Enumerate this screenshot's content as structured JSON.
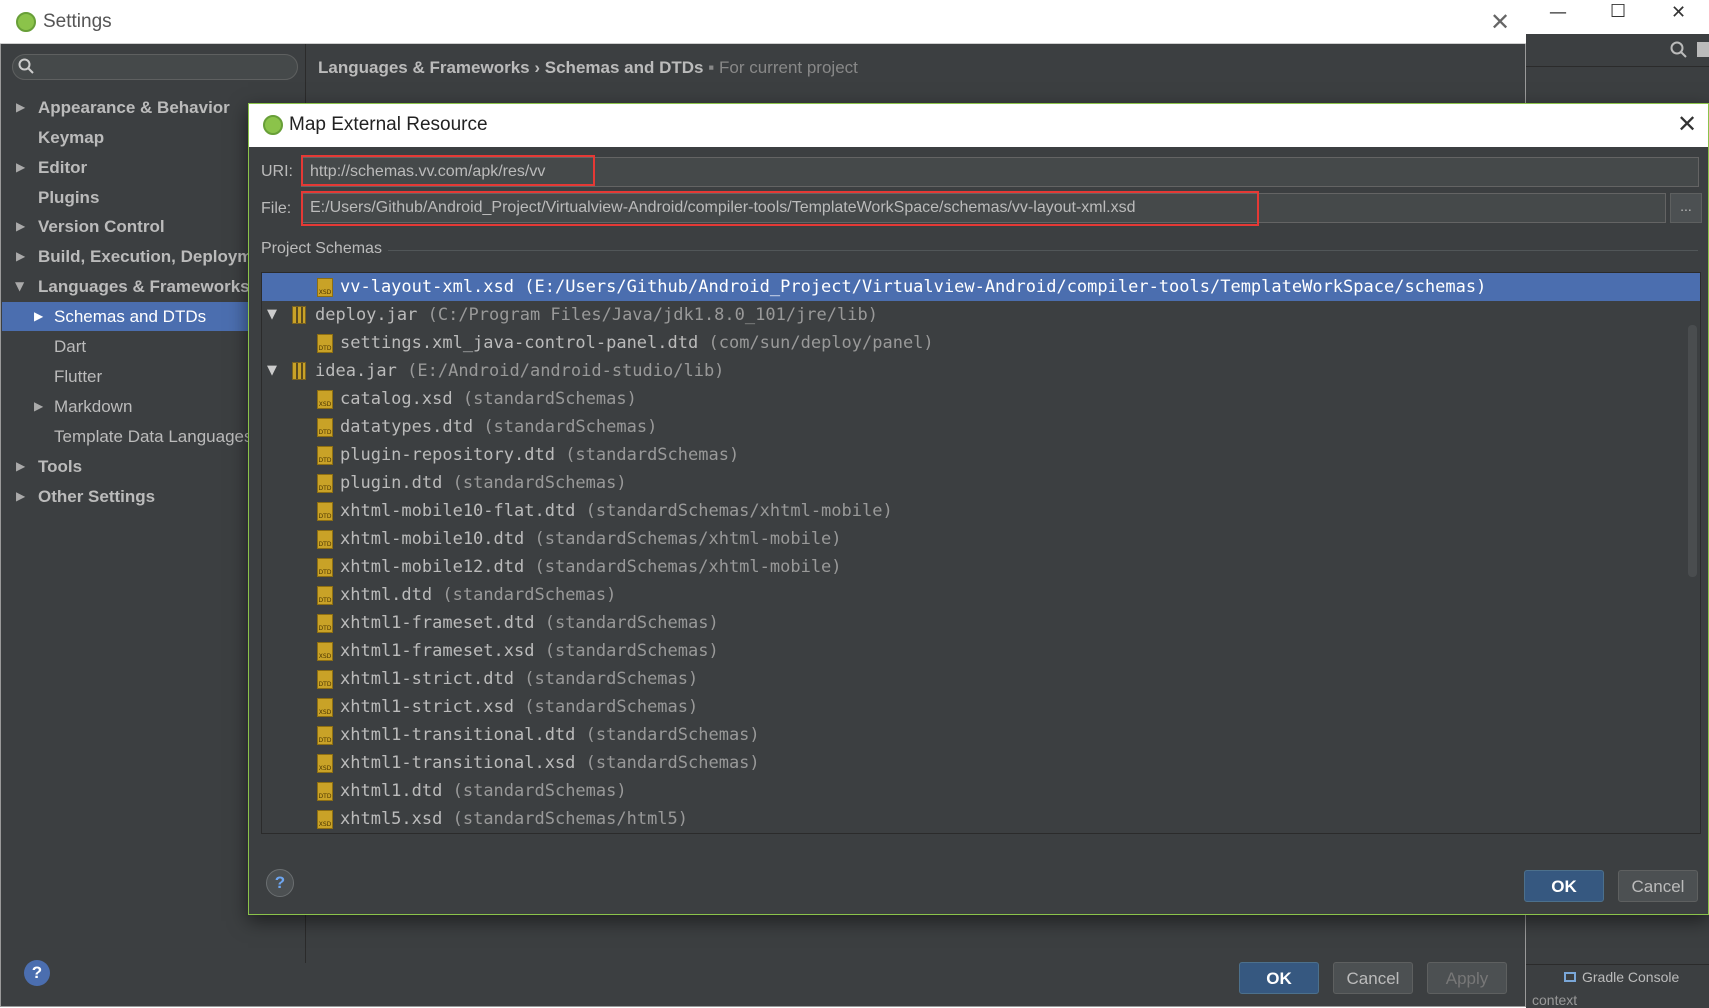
{
  "background_ide": {
    "window_controls": [
      "—",
      "☐",
      "✕"
    ],
    "tool_window_label": "Gradle Console",
    "status_text": "context"
  },
  "settings": {
    "title": "Settings",
    "search": {
      "value": "",
      "placeholder": ""
    },
    "nav": [
      {
        "label": "Appearance & Behavior",
        "bold": true,
        "expandable": true
      },
      {
        "label": "Keymap",
        "bold": true,
        "expandable": false
      },
      {
        "label": "Editor",
        "bold": true,
        "expandable": true
      },
      {
        "label": "Plugins",
        "bold": true,
        "expandable": false
      },
      {
        "label": "Version Control",
        "bold": true,
        "expandable": true
      },
      {
        "label": "Build, Execution, Deployment",
        "bold": true,
        "expandable": true
      },
      {
        "label": "Languages & Frameworks",
        "bold": true,
        "expandable": true,
        "expanded": true
      },
      {
        "label": "Schemas and DTDs",
        "bold": false,
        "expandable": true,
        "selected": true
      },
      {
        "label": "Dart",
        "bold": false
      },
      {
        "label": "Flutter",
        "bold": false
      },
      {
        "label": "Markdown",
        "bold": false,
        "expandable": true
      },
      {
        "label": "Template Data Languages",
        "bold": false
      },
      {
        "label": "Tools",
        "bold": true,
        "expandable": true
      },
      {
        "label": "Other Settings",
        "bold": true,
        "expandable": true
      }
    ],
    "breadcrumb": {
      "parent": "Languages & Frameworks",
      "separator": "›",
      "current": "Schemas and DTDs",
      "scope": "For current project"
    },
    "buttons": {
      "help": "?",
      "ok": "OK",
      "cancel": "Cancel",
      "apply": "Apply"
    }
  },
  "dialog": {
    "title": "Map External Resource",
    "uri_label": "URI:",
    "uri_value": "http://schemas.vv.com/apk/res/vv",
    "file_label": "File:",
    "file_value": "E:/Users/Github/Android_Project/Virtualview-Android/compiler-tools/TemplateWorkSpace/schemas/vv-layout-xml.xsd",
    "browse_label": "...",
    "section_title": "Project Schemas",
    "tree": [
      {
        "name": "vv-layout-xml.xsd",
        "path": "(E:/Users/Github/Android_Project/Virtualview-Android/compiler-tools/TemplateWorkSpace/schemas)",
        "icon": "XSD",
        "level": 1,
        "selected": true
      },
      {
        "name": "deploy.jar",
        "path": "(C:/Program Files/Java/jdk1.8.0_101/jre/lib)",
        "icon": "jar",
        "level": 0,
        "expanded": true
      },
      {
        "name": "settings.xml_java-control-panel.dtd",
        "path": "(com/sun/deploy/panel)",
        "icon": "DTD",
        "level": 1
      },
      {
        "name": "idea.jar",
        "path": "(E:/Android/android-studio/lib)",
        "icon": "jar",
        "level": 0,
        "expanded": true
      },
      {
        "name": "catalog.xsd",
        "path": "(standardSchemas)",
        "icon": "XSD",
        "level": 1
      },
      {
        "name": "datatypes.dtd",
        "path": "(standardSchemas)",
        "icon": "DTD",
        "level": 1
      },
      {
        "name": "plugin-repository.dtd",
        "path": "(standardSchemas)",
        "icon": "DTD",
        "level": 1
      },
      {
        "name": "plugin.dtd",
        "path": "(standardSchemas)",
        "icon": "DTD",
        "level": 1
      },
      {
        "name": "xhtml-mobile10-flat.dtd",
        "path": "(standardSchemas/xhtml-mobile)",
        "icon": "DTD",
        "level": 1
      },
      {
        "name": "xhtml-mobile10.dtd",
        "path": "(standardSchemas/xhtml-mobile)",
        "icon": "DTD",
        "level": 1
      },
      {
        "name": "xhtml-mobile12.dtd",
        "path": "(standardSchemas/xhtml-mobile)",
        "icon": "DTD",
        "level": 1
      },
      {
        "name": "xhtml.dtd",
        "path": "(standardSchemas)",
        "icon": "DTD",
        "level": 1
      },
      {
        "name": "xhtml1-frameset.dtd",
        "path": "(standardSchemas)",
        "icon": "DTD",
        "level": 1
      },
      {
        "name": "xhtml1-frameset.xsd",
        "path": "(standardSchemas)",
        "icon": "XSD",
        "level": 1
      },
      {
        "name": "xhtml1-strict.dtd",
        "path": "(standardSchemas)",
        "icon": "DTD",
        "level": 1
      },
      {
        "name": "xhtml1-strict.xsd",
        "path": "(standardSchemas)",
        "icon": "XSD",
        "level": 1
      },
      {
        "name": "xhtml1-transitional.dtd",
        "path": "(standardSchemas)",
        "icon": "DTD",
        "level": 1
      },
      {
        "name": "xhtml1-transitional.xsd",
        "path": "(standardSchemas)",
        "icon": "XSD",
        "level": 1
      },
      {
        "name": "xhtml1.dtd",
        "path": "(standardSchemas)",
        "icon": "DTD",
        "level": 1
      },
      {
        "name": "xhtml5.xsd",
        "path": "(standardSchemas/html5)",
        "icon": "XSD",
        "level": 1
      }
    ],
    "buttons": {
      "help": "?",
      "ok": "OK",
      "cancel": "Cancel"
    }
  },
  "colors": {
    "panel_bg": "#3c3f41",
    "selection": "#4b6eaf",
    "primary_button": "#365880",
    "highlight_box": "#e53935",
    "dialog_border": "#8bc34a"
  }
}
